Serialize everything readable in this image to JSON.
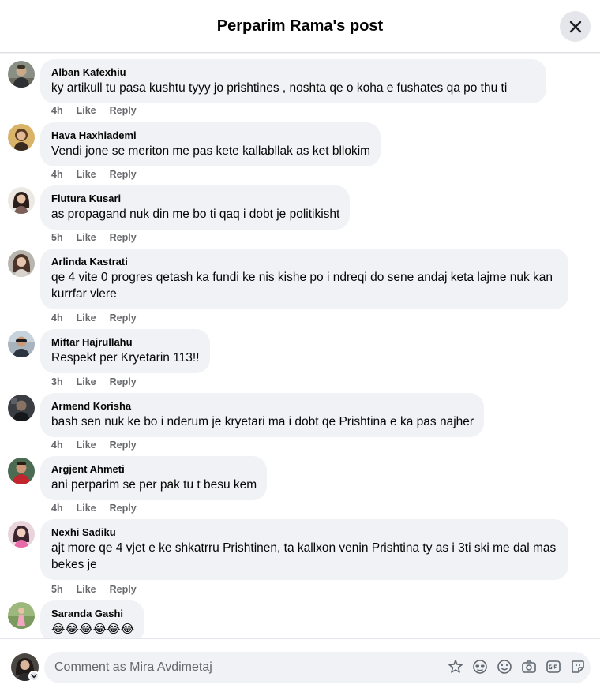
{
  "header": {
    "title": "Perparim Rama's post"
  },
  "comments": [
    {
      "author": "Alban Kafexhiu",
      "text": "ky artikull tu pasa kushtu tyyy jo prishtines , noshta qe o koha e fushates qa po thu ti",
      "time": "4h",
      "like": "Like",
      "reply": "Reply"
    },
    {
      "author": "Hava Haxhiademi",
      "text": "Vendi jone se meriton me pas kete kallabllak as ket bllokim",
      "time": "4h",
      "like": "Like",
      "reply": "Reply"
    },
    {
      "author": "Flutura Kusari",
      "text": "as propagand nuk din me bo ti qaq i dobt je politikisht",
      "time": "5h",
      "like": "Like",
      "reply": "Reply"
    },
    {
      "author": "Arlinda Kastrati",
      "text": "qe 4 vite 0 progres qetash ka fundi ke nis kishe po i ndreqi do sene andaj keta lajme nuk kan kurrfar vlere",
      "time": "4h",
      "like": "Like",
      "reply": "Reply"
    },
    {
      "author": "Miftar Hajrullahu",
      "text": "Respekt per Kryetarin 113!!",
      "time": "3h",
      "like": "Like",
      "reply": "Reply"
    },
    {
      "author": "Armend Korisha",
      "text": "bash sen nuk ke bo i nderum je kryetari ma i dobt qe Prishtina e ka pas najher",
      "time": "4h",
      "like": "Like",
      "reply": "Reply"
    },
    {
      "author": "Argjent Ahmeti",
      "text": "ani perparim se per pak tu t besu kem",
      "time": "4h",
      "like": "Like",
      "reply": "Reply"
    },
    {
      "author": "Nexhi Sadiku",
      "text": "ajt more qe 4 vjet e ke shkatrru Prishtinen, ta kallxon venin Prishtina ty as i 3ti ski me dal mas bekes je",
      "time": "5h",
      "like": "Like",
      "reply": "Reply"
    },
    {
      "author": "Saranda Gashi",
      "text": "😂😂😂😂😂😂",
      "time": "",
      "like": "",
      "reply": ""
    }
  ],
  "composer": {
    "placeholder": "Comment as Mira Avdimetaj",
    "icons": [
      "avatar-sticker-icon",
      "emoji-face-icon",
      "smiley-icon",
      "camera-icon",
      "gif-icon",
      "sticker-icon"
    ]
  },
  "colors": {
    "bubble": "#f0f2f5",
    "meta": "#65676b",
    "close_bg": "#e4e6eb"
  }
}
